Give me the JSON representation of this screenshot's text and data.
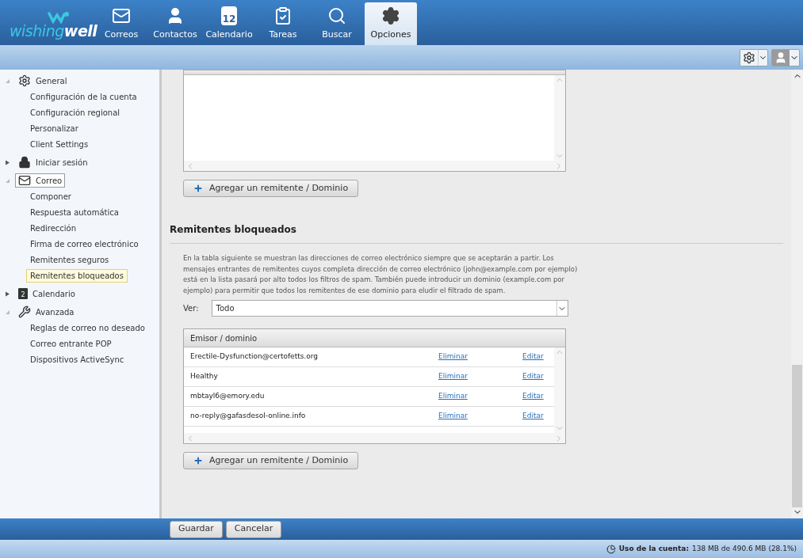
{
  "logo": {
    "part_1": "wishing",
    "part_2": "well"
  },
  "nav": [
    {
      "label": "Correos",
      "kind": "mail",
      "selected": false
    },
    {
      "label": "Contactos",
      "kind": "person",
      "selected": false
    },
    {
      "label": "Calendario",
      "kind": "calendar",
      "badge": "12",
      "selected": false
    },
    {
      "label": "Tareas",
      "kind": "tasks",
      "selected": false
    },
    {
      "label": "Buscar",
      "kind": "search",
      "selected": false
    },
    {
      "label": "Opciones",
      "kind": "gear",
      "selected": true
    }
  ],
  "sidebar": {
    "groups": [
      {
        "label": "General",
        "kind": "gear",
        "expanded": true,
        "selected": false,
        "children": [
          {
            "label": "Configuración de la cuenta",
            "selected": false
          },
          {
            "label": "Configuración regional",
            "selected": false
          },
          {
            "label": "Personalizar",
            "selected": false
          },
          {
            "label": "Client Settings",
            "selected": false
          }
        ]
      },
      {
        "label": "Iniciar sesión",
        "kind": "lock",
        "expanded": false,
        "selected": false
      },
      {
        "label": "Correo",
        "kind": "mail",
        "expanded": true,
        "selected": true,
        "children": [
          {
            "label": "Componer",
            "selected": false
          },
          {
            "label": "Respuesta automática",
            "selected": false
          },
          {
            "label": "Redirección",
            "selected": false
          },
          {
            "label": "Firma de correo electrónico",
            "selected": false
          },
          {
            "label": "Remitentes seguros",
            "selected": false
          },
          {
            "label": "Remitentes bloqueados",
            "selected": true
          }
        ]
      },
      {
        "label": "Calendario",
        "kind": "calendar",
        "badge": "2",
        "expanded": false,
        "selected": false
      },
      {
        "label": "Avanzada",
        "kind": "tools",
        "expanded": true,
        "selected": false,
        "children": [
          {
            "label": "Reglas de correo no deseado",
            "selected": false
          },
          {
            "label": "Correo entrante POP",
            "selected": false
          },
          {
            "label": "Dispositivos ActiveSync",
            "selected": false
          }
        ]
      }
    ]
  },
  "top_section": {
    "add_button": "Agregar un remitente / Dominio"
  },
  "blocked": {
    "title": "Remitentes bloqueados",
    "description": "En la tabla siguiente se muestran las direcciones de correo electrónico siempre que se aceptarán a partir. Los mensajes entrantes de remitentes cuyos completa dirección de correo electrónico (john@example.com por ejemplo) está en la lista pasará por alto todos los filtros de spam. También puede introducir un dominio (example.com por ejemplo) para permitir que todos los remitentes de ese dominio para eludir el filtrado de spam.",
    "filter_label": "Ver:",
    "filter_value": "Todo",
    "column": "Emisor / dominio",
    "rows": [
      {
        "sender": "Erectile-Dysfunction@certofetts.org",
        "delete": "Eliminar",
        "edit": "Editar"
      },
      {
        "sender": "Healthy",
        "delete": "Eliminar",
        "edit": "Editar"
      },
      {
        "sender": "mbtayl6@emory.edu",
        "delete": "Eliminar",
        "edit": "Editar"
      },
      {
        "sender": "no-reply@gafasdesol-online.info",
        "delete": "Eliminar",
        "edit": "Editar"
      }
    ],
    "add_button": "Agregar un remitente / Dominio"
  },
  "footer": {
    "save": "Guardar",
    "cancel": "Cancelar"
  },
  "status": {
    "label": "Uso de la cuenta:",
    "value": "138 MB de 490.6 MB (28.1%)"
  }
}
